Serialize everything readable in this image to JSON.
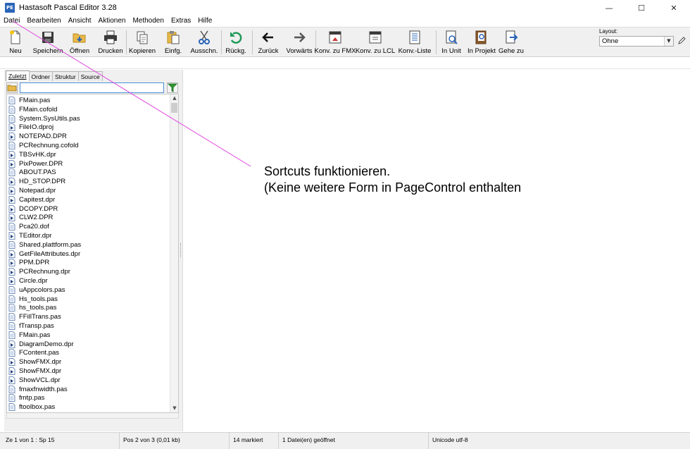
{
  "window": {
    "title": "Hastasoft Pascal Editor 3.28",
    "app_icon_text": "PE",
    "minimize_glyph": "—",
    "maximize_glyph": "☐",
    "close_glyph": "✕"
  },
  "menu": [
    "Datei",
    "Bearbeiten",
    "Ansicht",
    "Aktionen",
    "Methoden",
    "Extras",
    "Hilfe"
  ],
  "toolbar": {
    "buttons": [
      {
        "label": "Neu",
        "icon": "new-file-icon"
      },
      {
        "label": "Speichern",
        "icon": "save-icon"
      },
      {
        "label": "Öffnen",
        "icon": "open-folder-icon"
      },
      {
        "label": "Drucken",
        "icon": "print-icon"
      },
      {
        "label": "Kopieren",
        "icon": "copy-icon"
      },
      {
        "label": "Einfg.",
        "icon": "paste-icon"
      },
      {
        "label": "Ausschn.",
        "icon": "cut-icon"
      },
      {
        "label": "Rückg.",
        "icon": "undo-icon"
      },
      {
        "label": "Zurück",
        "icon": "arrow-left-icon"
      },
      {
        "label": "Vorwärts",
        "icon": "arrow-right-icon"
      },
      {
        "label": "Konv. zu FMX",
        "icon": "convert-fmx-icon"
      },
      {
        "label": "Konv. zu LCL",
        "icon": "convert-lcl-icon"
      },
      {
        "label": "Konv.-Liste",
        "icon": "convert-list-icon"
      },
      {
        "label": "In Unit",
        "icon": "find-in-unit-icon"
      },
      {
        "label": "In Projekt",
        "icon": "find-in-project-icon"
      },
      {
        "label": "Gehe zu",
        "icon": "goto-icon"
      }
    ],
    "layout_label": "Layout:",
    "layout_value": "Ohne"
  },
  "left_panel": {
    "tabs": [
      "Zuletzt",
      "Ordner",
      "Struktur",
      "Source"
    ],
    "active_tab": "Zuletzt",
    "search_value": "",
    "files": [
      {
        "name": "FMain.pas",
        "type": "pas"
      },
      {
        "name": "FMain.cofold",
        "type": "pas"
      },
      {
        "name": "System.SysUtils.pas",
        "type": "pas"
      },
      {
        "name": "FileIO.dproj",
        "type": "dpr"
      },
      {
        "name": "NOTEPAD.DPR",
        "type": "dpr"
      },
      {
        "name": "PCRechnung.cofold",
        "type": "pas"
      },
      {
        "name": "TBSvHK.dpr",
        "type": "dpr"
      },
      {
        "name": "PixPower.DPR",
        "type": "dpr"
      },
      {
        "name": "ABOUT.PAS",
        "type": "pas"
      },
      {
        "name": "HD_STOP.DPR",
        "type": "dpr"
      },
      {
        "name": "Notepad.dpr",
        "type": "dpr"
      },
      {
        "name": "Capitest.dpr",
        "type": "dpr"
      },
      {
        "name": "DCOPY.DPR",
        "type": "dpr"
      },
      {
        "name": "CLW2.DPR",
        "type": "dpr"
      },
      {
        "name": "Pca20.dof",
        "type": "pas"
      },
      {
        "name": "TEditor.dpr",
        "type": "dpr"
      },
      {
        "name": "Shared.plattform.pas",
        "type": "pas"
      },
      {
        "name": "GetFileAttributes.dpr",
        "type": "dpr"
      },
      {
        "name": "PPM.DPR",
        "type": "dpr"
      },
      {
        "name": "PCRechnung.dpr",
        "type": "dpr"
      },
      {
        "name": "Circle.dpr",
        "type": "dpr"
      },
      {
        "name": "uAppcolors.pas",
        "type": "pas"
      },
      {
        "name": "Hs_tools.pas",
        "type": "pas"
      },
      {
        "name": "hs_tools.pas",
        "type": "pas"
      },
      {
        "name": "FFillTrans.pas",
        "type": "pas"
      },
      {
        "name": "fTransp.pas",
        "type": "pas"
      },
      {
        "name": "FMain.pas",
        "type": "pas"
      },
      {
        "name": "DiagramDemo.dpr",
        "type": "dpr"
      },
      {
        "name": "FContent.pas",
        "type": "pas"
      },
      {
        "name": "ShowFMX.dpr",
        "type": "dpr"
      },
      {
        "name": "ShowFMX.dpr",
        "type": "dpr"
      },
      {
        "name": "ShowVCL.dpr",
        "type": "dpr"
      },
      {
        "name": "fmaxfnwidth.pas",
        "type": "pas"
      },
      {
        "name": "fmtp.pas",
        "type": "pas"
      },
      {
        "name": "ftoolbox.pas",
        "type": "pas"
      }
    ]
  },
  "editor": {
    "note_lines": [
      "Sortcuts funktionieren.",
      "(Keine weitere Form in PageControl enthalten"
    ]
  },
  "status": {
    "cells": [
      "Ze 1 von 1 : Sp 15",
      "Pos 2 von 3 (0,01 kb)",
      "14 markiert",
      "1 Datei(en) geöffnet",
      "Unicode utf-8"
    ]
  },
  "colors": {
    "accent": "#2a64b8",
    "annotation_line": "#e040e0",
    "panel_bg": "#f0f0f0"
  }
}
